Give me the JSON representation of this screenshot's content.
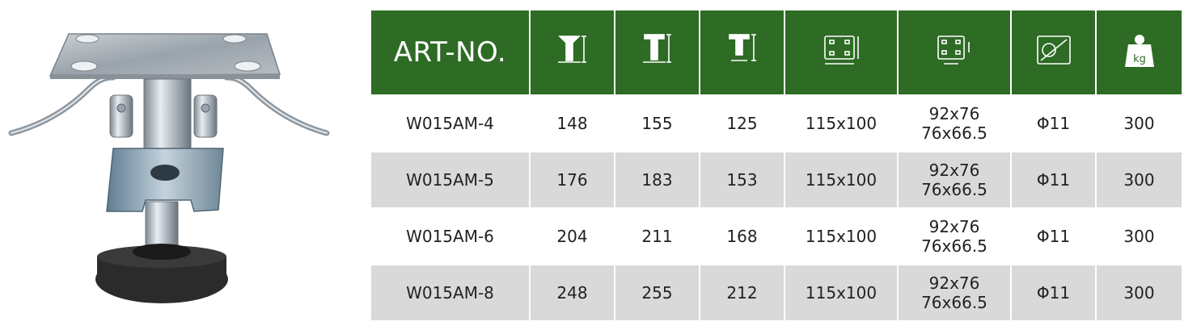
{
  "table": {
    "art_header": "ART-NO.",
    "header_icons": [
      {
        "name": "overall-height-icon"
      },
      {
        "name": "mount-height-icon"
      },
      {
        "name": "stroke-height-icon"
      },
      {
        "name": "plate-size-icon"
      },
      {
        "name": "bolt-hole-spacing-icon"
      },
      {
        "name": "bolt-hole-diameter-icon"
      },
      {
        "name": "load-capacity-icon",
        "label": "kg"
      }
    ],
    "rows": [
      {
        "art": "W015AM-4",
        "c1": "148",
        "c2": "155",
        "c3": "125",
        "plate": "115x100",
        "holes_a": "92x76",
        "holes_b": "76x66.5",
        "bolt": "Φ11",
        "load": "300"
      },
      {
        "art": "W015AM-5",
        "c1": "176",
        "c2": "183",
        "c3": "153",
        "plate": "115x100",
        "holes_a": "92x76",
        "holes_b": "76x66.5",
        "bolt": "Φ11",
        "load": "300"
      },
      {
        "art": "W015AM-6",
        "c1": "204",
        "c2": "211",
        "c3": "168",
        "plate": "115x100",
        "holes_a": "92x76",
        "holes_b": "76x66.5",
        "bolt": "Φ11",
        "load": "300"
      },
      {
        "art": "W015AM-8",
        "c1": "248",
        "c2": "255",
        "c3": "212",
        "plate": "115x100",
        "holes_a": "92x76",
        "holes_b": "76x66.5",
        "bolt": "Φ11",
        "load": "300"
      }
    ]
  },
  "colors": {
    "header_green": "#2e6b25",
    "row_gray": "#d9d9d9",
    "row_white": "#ffffff"
  }
}
